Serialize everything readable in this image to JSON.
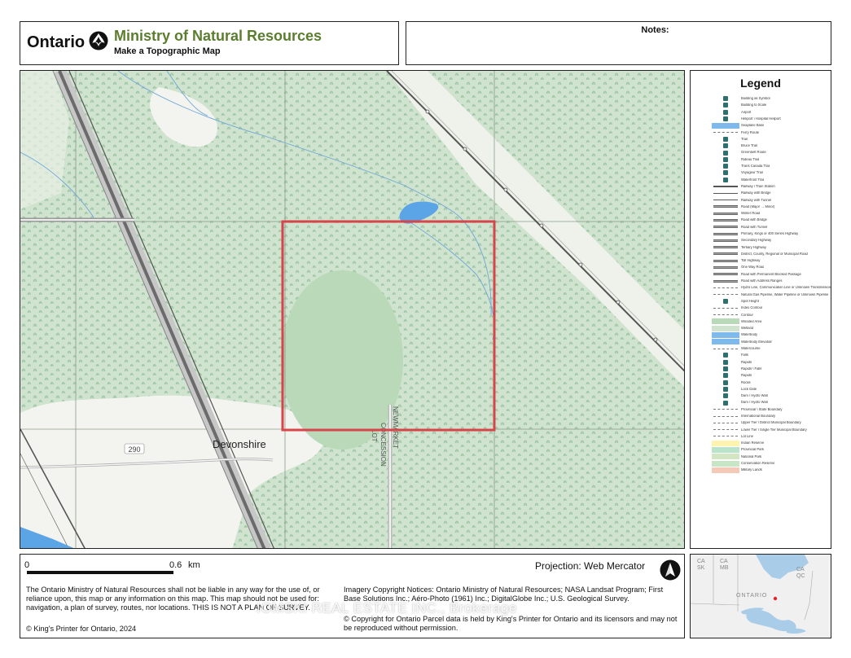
{
  "header": {
    "brand": "Ontario",
    "ministry": "Ministry of Natural Resources",
    "subtitle": "Make a Topographic Map"
  },
  "notes": {
    "label": "Notes:"
  },
  "map": {
    "place_label": "Devonshire",
    "road_number": "290",
    "road_names": [
      "LOT",
      "CONCESSION",
      "NEWMARKET"
    ],
    "colors": {
      "wetland": "#cfe3cf",
      "wooded": "#b9d9b9",
      "clear": "#f3f4ef",
      "water": "#5ba4e6",
      "parcel": "#d9444a",
      "rail": "#555555"
    }
  },
  "legend": {
    "title": "Legend",
    "items": [
      {
        "label": "Building as Symbol",
        "icon": "building-symbol"
      },
      {
        "label": "Building to Scale",
        "icon": "building-scale"
      },
      {
        "label": "Airport",
        "icon": "airport"
      },
      {
        "label": "Heliport \\ Hospital Heliport",
        "icon": "heliport"
      },
      {
        "label": "Seaplane Base",
        "icon": "seaplane"
      },
      {
        "label": "Ferry Route",
        "icon": "ferry"
      },
      {
        "label": "Trail",
        "icon": "trail"
      },
      {
        "label": "Bruce Trail",
        "icon": "bruce-trail"
      },
      {
        "label": "Greenbelt Route",
        "icon": "greenbelt"
      },
      {
        "label": "Rideau Trail",
        "icon": "rideau"
      },
      {
        "label": "Trans Canada Trail",
        "icon": "trans-canada"
      },
      {
        "label": "Voyageur Trail",
        "icon": "voyageur"
      },
      {
        "label": "Waterfront Trail",
        "icon": "waterfront"
      },
      {
        "label": "Railway \\ Train Station",
        "icon": "railway-station"
      },
      {
        "label": "Railway with Bridge",
        "icon": "railway-bridge"
      },
      {
        "label": "Railway with Tunnel",
        "icon": "railway-tunnel"
      },
      {
        "label": "Road (Major → Minor)",
        "icon": "road-major"
      },
      {
        "label": "Winter Road",
        "icon": "winter-road"
      },
      {
        "label": "Road with Bridge",
        "icon": "road-bridge"
      },
      {
        "label": "Road with Tunnel",
        "icon": "road-tunnel"
      },
      {
        "label": "Primary, Kings or 400 Series Highway",
        "icon": "primary-hwy"
      },
      {
        "label": "Secondary Highway",
        "icon": "secondary-hwy"
      },
      {
        "label": "Tertiary Highway",
        "icon": "tertiary-hwy"
      },
      {
        "label": "District, County, Regional or Municipal Road",
        "icon": "district-road"
      },
      {
        "label": "Toll Highway",
        "icon": "toll-hwy"
      },
      {
        "label": "One Way Road",
        "icon": "one-way"
      },
      {
        "label": "Road with Permanent Blocked Passage",
        "icon": "blocked-road"
      },
      {
        "label": "Road with Address Ranges",
        "icon": "address-road"
      },
      {
        "label": "Hydro Line, Communication Line or Unknown Transmission Line",
        "icon": "hydro-line"
      },
      {
        "label": "Natural Gas Pipeline, Water Pipeline or Unknown Pipeline",
        "icon": "pipeline"
      },
      {
        "label": "Spot Height",
        "icon": "spot-height"
      },
      {
        "label": "Index Contour",
        "icon": "index-contour"
      },
      {
        "label": "Contour",
        "icon": "contour"
      },
      {
        "label": "Wooded Area",
        "icon": "wooded"
      },
      {
        "label": "Wetland",
        "icon": "wetland"
      },
      {
        "label": "Waterbody",
        "icon": "waterbody"
      },
      {
        "label": "Waterbody Elevation",
        "icon": "water-elevation"
      },
      {
        "label": "Watercourse",
        "icon": "watercourse"
      },
      {
        "label": "Falls",
        "icon": "falls"
      },
      {
        "label": "Rapids",
        "icon": "rapids"
      },
      {
        "label": "Rapids \\ Falls",
        "icon": "rapids-falls"
      },
      {
        "label": "Rapids",
        "icon": "rapids-2"
      },
      {
        "label": "Rocks",
        "icon": "rocks"
      },
      {
        "label": "Lock Gate",
        "icon": "lock-gate"
      },
      {
        "label": "Dam \\ Hydro Wall",
        "icon": "dam"
      },
      {
        "label": "Dam \\ Hydro Wall",
        "icon": "dam-2"
      },
      {
        "label": "Provincial \\ State Boundary",
        "icon": "prov-boundary"
      },
      {
        "label": "International Boundary",
        "icon": "intl-boundary"
      },
      {
        "label": "Upper Tier \\ District Municipal Boundary",
        "icon": "upper-tier"
      },
      {
        "label": "Lower Tier \\ Single Tier Municipal Boundary",
        "icon": "lower-tier"
      },
      {
        "label": "Lot Line",
        "icon": "lot-line"
      },
      {
        "label": "Indian Reserve",
        "icon": "indian-reserve"
      },
      {
        "label": "Provincial Park",
        "icon": "prov-park"
      },
      {
        "label": "National Park",
        "icon": "nat-park"
      },
      {
        "label": "Conservation Reserve",
        "icon": "conservation"
      },
      {
        "label": "Military Lands",
        "icon": "military"
      }
    ]
  },
  "footer": {
    "scale": {
      "start": "0",
      "end": "0.6",
      "unit": "km"
    },
    "projection": "Projection: Web Mercator",
    "disclaimer": "The Ontario Ministry of Natural Resources shall not be liable in any way for the use of, or reliance upon, this map or any information on this map.  This map should not be used for: navigation, a plan of survey, routes, nor locations. THIS IS NOT A PLAN OF SURVEY.",
    "kings_copyright": "© King's Printer for Ontario,  2024",
    "imagery": "Imagery Copyright Notices: Ontario Ministry of Natural Resources; NASA Landsat Program; First Base Solutions Inc.; Aéro-Photo (1961) Inc.; DigitalGlobe Inc.; U.S. Geological Survey.",
    "parcel": "© Copyright for Ontario Parcel data is held by King's Printer for Ontario and its licensors and may not be reproduced without permission.",
    "watermark": "IOMSKI REAL ESTATE INC., Brokerage"
  },
  "inset": {
    "labels": {
      "ca_sk": "CA\nSK",
      "ca_mb": "CA\nMB",
      "ca_qc": "CA\nQC",
      "province": "ONTARIO"
    },
    "colors": {
      "land": "#f0f0f0",
      "water": "#a9cde8",
      "locator": "#e0262d"
    }
  }
}
